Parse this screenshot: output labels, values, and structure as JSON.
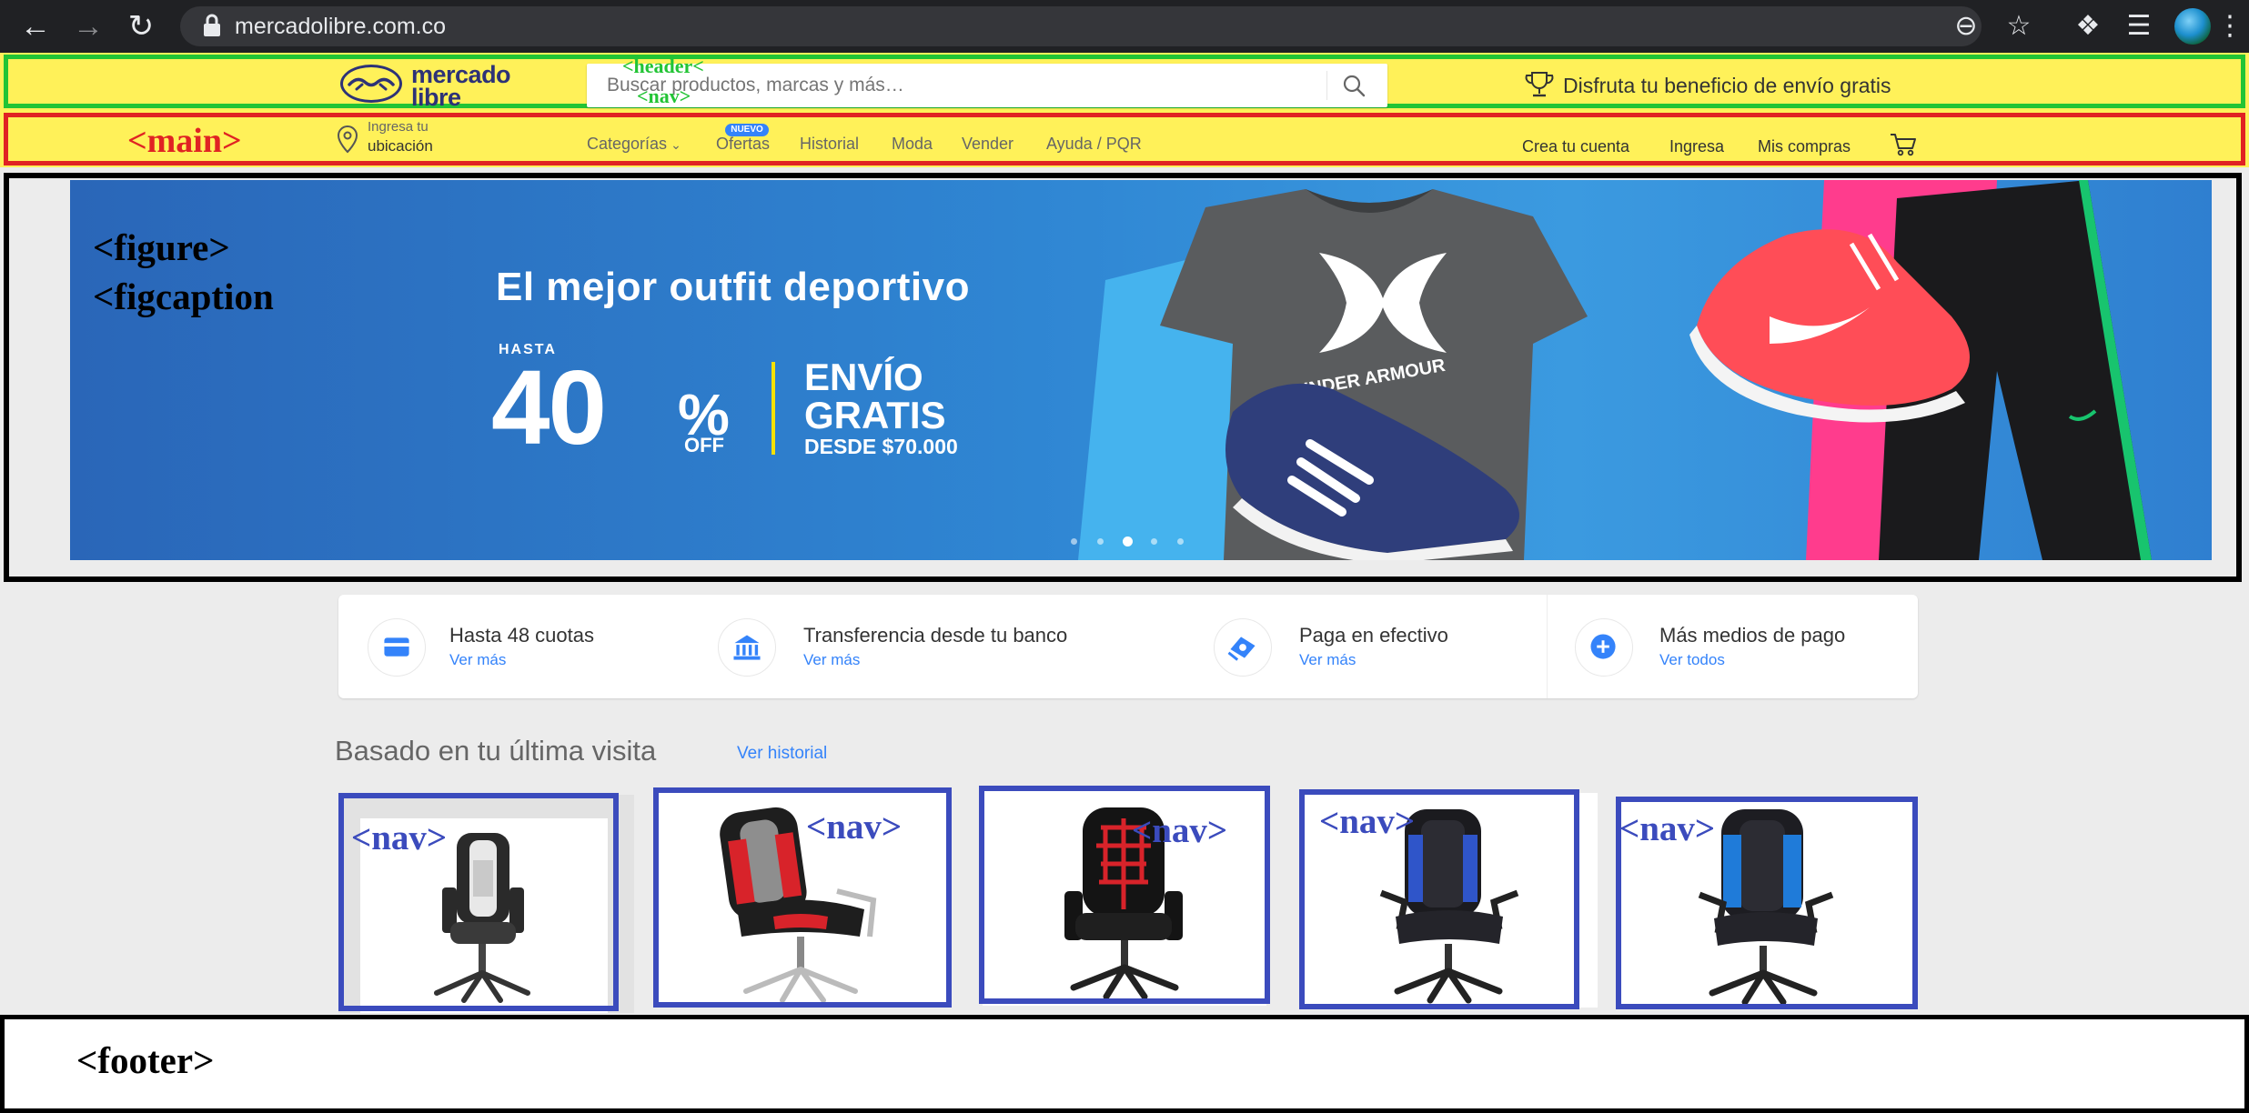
{
  "browser": {
    "url": "mercadolibre.com.co"
  },
  "annotations": {
    "header": "<header<",
    "nav": "<nav>",
    "main": "<main>",
    "figure": "<figure>",
    "figcaption": "<figcaption",
    "product_nav": "<nav>",
    "footer": "<footer>"
  },
  "header": {
    "logo_line1": "mercado",
    "logo_line2": "libre",
    "search_placeholder": "Buscar productos, marcas y más…",
    "promo": "Disfruta tu beneficio de envío gratis"
  },
  "nav": {
    "location_line1": "Ingresa tu",
    "location_line2": "ubicación",
    "links": [
      "Categorías",
      "Ofertas",
      "Historial",
      "Moda",
      "Vender",
      "Ayuda / PQR"
    ],
    "new_badge": "NUEVO",
    "user_links": [
      "Crea tu cuenta",
      "Ingresa",
      "Mis compras"
    ]
  },
  "banner": {
    "title": "El mejor outfit deportivo",
    "hasta": "HASTA",
    "percent": "40",
    "percent_sign": "%",
    "off": "OFF",
    "envio": "ENVÍO",
    "gratis": "GRATIS",
    "desde": "DESDE $70.000",
    "brand_text": "UNDER ARMOUR",
    "dots": 5,
    "active_dot": 3
  },
  "payments": [
    {
      "title": "Hasta 48 cuotas",
      "link": "Ver más",
      "icon": "credit-card-icon"
    },
    {
      "title": "Transferencia desde tu banco",
      "link": "Ver más",
      "icon": "bank-icon"
    },
    {
      "title": "Paga en efectivo",
      "link": "Ver más",
      "icon": "cash-icon"
    },
    {
      "title": "Más medios de pago",
      "link": "Ver todos",
      "icon": "plus-icon"
    }
  ],
  "history": {
    "title": "Basado en tu última visita",
    "link": "Ver historial",
    "products": [
      {
        "name": "gaming-chair-white"
      },
      {
        "name": "gaming-chair-red-grey"
      },
      {
        "name": "gaming-chair-red-black"
      },
      {
        "name": "gaming-chair-blue-black"
      },
      {
        "name": "gaming-chair-blue"
      }
    ]
  },
  "colors": {
    "header_yellow": "#fff159",
    "header_outline": "#22c435",
    "main_outline": "#e02323",
    "annotation_blue": "#3b4bbd",
    "link_blue": "#3483fa",
    "logo_navy": "#2d3277"
  }
}
